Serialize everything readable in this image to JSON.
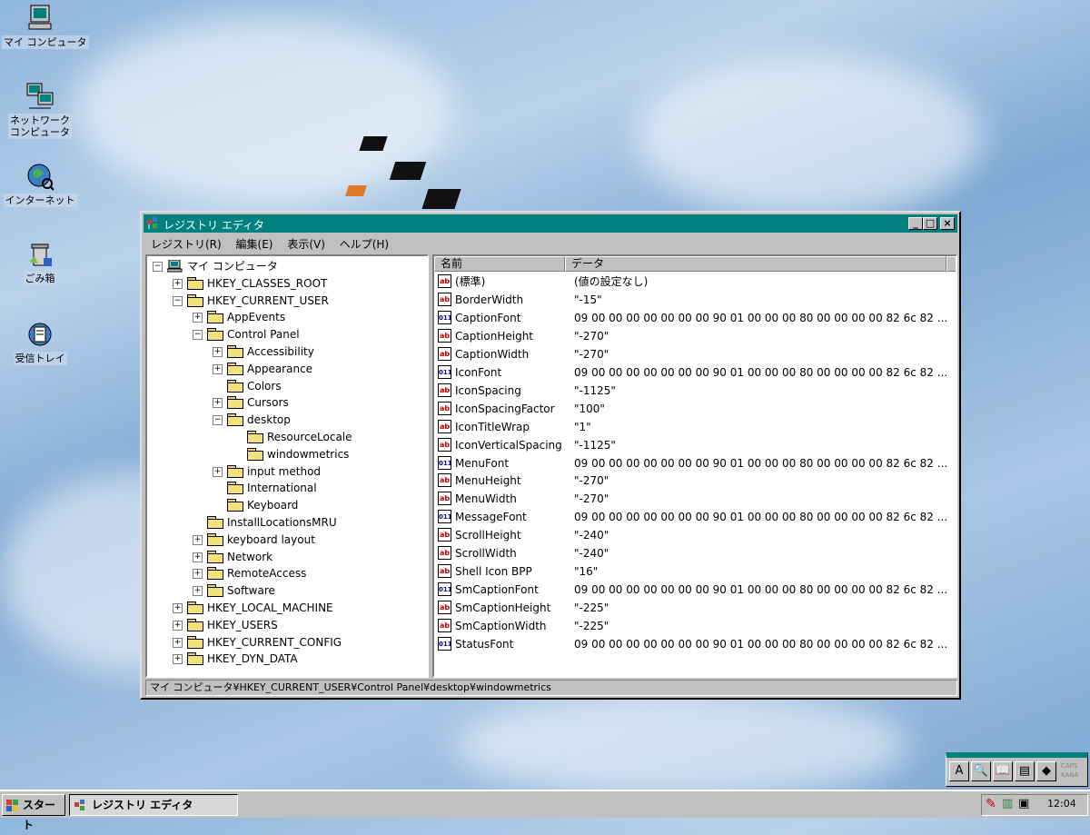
{
  "desktop": {
    "icons": [
      {
        "label": "マイ コンピュータ"
      },
      {
        "label": "ネットワーク\nコンピュータ"
      },
      {
        "label": "インターネット"
      },
      {
        "label": "ごみ箱"
      },
      {
        "label": "受信トレイ"
      }
    ]
  },
  "window": {
    "title": "レジストリ エディタ",
    "menu": [
      "レジストリ(R)",
      "編集(E)",
      "表示(V)",
      "ヘルプ(H)"
    ],
    "tree": [
      {
        "label": "マイ コンピュータ",
        "toggle": "−"
      },
      {
        "label": "HKEY_CLASSES_ROOT",
        "toggle": "+"
      },
      {
        "label": "HKEY_CURRENT_USER",
        "toggle": "−"
      },
      {
        "label": "AppEvents",
        "toggle": "+"
      },
      {
        "label": "Control Panel",
        "toggle": "−"
      },
      {
        "label": "Accessibility",
        "toggle": "+"
      },
      {
        "label": "Appearance",
        "toggle": "+"
      },
      {
        "label": "Colors",
        "toggle": ""
      },
      {
        "label": "Cursors",
        "toggle": "+"
      },
      {
        "label": "desktop",
        "toggle": "−"
      },
      {
        "label": "ResourceLocale",
        "toggle": ""
      },
      {
        "label": "windowmetrics",
        "toggle": ""
      },
      {
        "label": "input method",
        "toggle": "+"
      },
      {
        "label": "International",
        "toggle": ""
      },
      {
        "label": "Keyboard",
        "toggle": ""
      },
      {
        "label": "InstallLocationsMRU",
        "toggle": ""
      },
      {
        "label": "keyboard layout",
        "toggle": "+"
      },
      {
        "label": "Network",
        "toggle": "+"
      },
      {
        "label": "RemoteAccess",
        "toggle": "+"
      },
      {
        "label": "Software",
        "toggle": "+"
      },
      {
        "label": "HKEY_LOCAL_MACHINE",
        "toggle": "+"
      },
      {
        "label": "HKEY_USERS",
        "toggle": "+"
      },
      {
        "label": "HKEY_CURRENT_CONFIG",
        "toggle": "+"
      },
      {
        "label": "HKEY_DYN_DATA",
        "toggle": "+"
      }
    ],
    "columns": {
      "name": "名前",
      "data": "データ"
    },
    "values": [
      {
        "icon": "ab",
        "name": "(標準)",
        "data": "(値の設定なし)"
      },
      {
        "icon": "ab",
        "name": "BorderWidth",
        "data": "\"-15\""
      },
      {
        "icon": "bin",
        "name": "CaptionFont",
        "data": "09 00 00 00 00 00 00 00 90 01 00 00 00 80 00 00 00 00 82 6c 82 ..."
      },
      {
        "icon": "ab",
        "name": "CaptionHeight",
        "data": "\"-270\""
      },
      {
        "icon": "ab",
        "name": "CaptionWidth",
        "data": "\"-270\""
      },
      {
        "icon": "bin",
        "name": "IconFont",
        "data": "09 00 00 00 00 00 00 00 90 01 00 00 00 80 00 00 00 00 82 6c 82 ..."
      },
      {
        "icon": "ab",
        "name": "IconSpacing",
        "data": "\"-1125\""
      },
      {
        "icon": "ab",
        "name": "IconSpacingFactor",
        "data": "\"100\""
      },
      {
        "icon": "ab",
        "name": "IconTitleWrap",
        "data": "\"1\""
      },
      {
        "icon": "ab",
        "name": "IconVerticalSpacing",
        "data": "\"-1125\""
      },
      {
        "icon": "bin",
        "name": "MenuFont",
        "data": "09 00 00 00 00 00 00 00 90 01 00 00 00 80 00 00 00 00 82 6c 82 ..."
      },
      {
        "icon": "ab",
        "name": "MenuHeight",
        "data": "\"-270\""
      },
      {
        "icon": "ab",
        "name": "MenuWidth",
        "data": "\"-270\""
      },
      {
        "icon": "bin",
        "name": "MessageFont",
        "data": "09 00 00 00 00 00 00 00 90 01 00 00 00 80 00 00 00 00 82 6c 82 ..."
      },
      {
        "icon": "ab",
        "name": "ScrollHeight",
        "data": "\"-240\""
      },
      {
        "icon": "ab",
        "name": "ScrollWidth",
        "data": "\"-240\""
      },
      {
        "icon": "ab",
        "name": "Shell Icon BPP",
        "data": "\"16\""
      },
      {
        "icon": "bin",
        "name": "SmCaptionFont",
        "data": "09 00 00 00 00 00 00 00 90 01 00 00 00 80 00 00 00 00 82 6c 82 ..."
      },
      {
        "icon": "ab",
        "name": "SmCaptionHeight",
        "data": "\"-225\""
      },
      {
        "icon": "ab",
        "name": "SmCaptionWidth",
        "data": "\"-225\""
      },
      {
        "icon": "bin",
        "name": "StatusFont",
        "data": "09 00 00 00 00 00 00 00 90 01 00 00 00 80 00 00 00 00 82 6c 82 ..."
      }
    ],
    "status": "マイ コンピュータ¥HKEY_CURRENT_USER¥Control Panel¥desktop¥windowmetrics"
  },
  "taskbar": {
    "start_label": "スタート",
    "task_label": "レジストリ エディタ",
    "clock": "12:04"
  },
  "ime": {
    "mode_label": "A",
    "caps": "CAPS",
    "kana": "KANA"
  },
  "colors": {
    "titlebar": "#00807f",
    "window_face": "#c0c0c0"
  }
}
